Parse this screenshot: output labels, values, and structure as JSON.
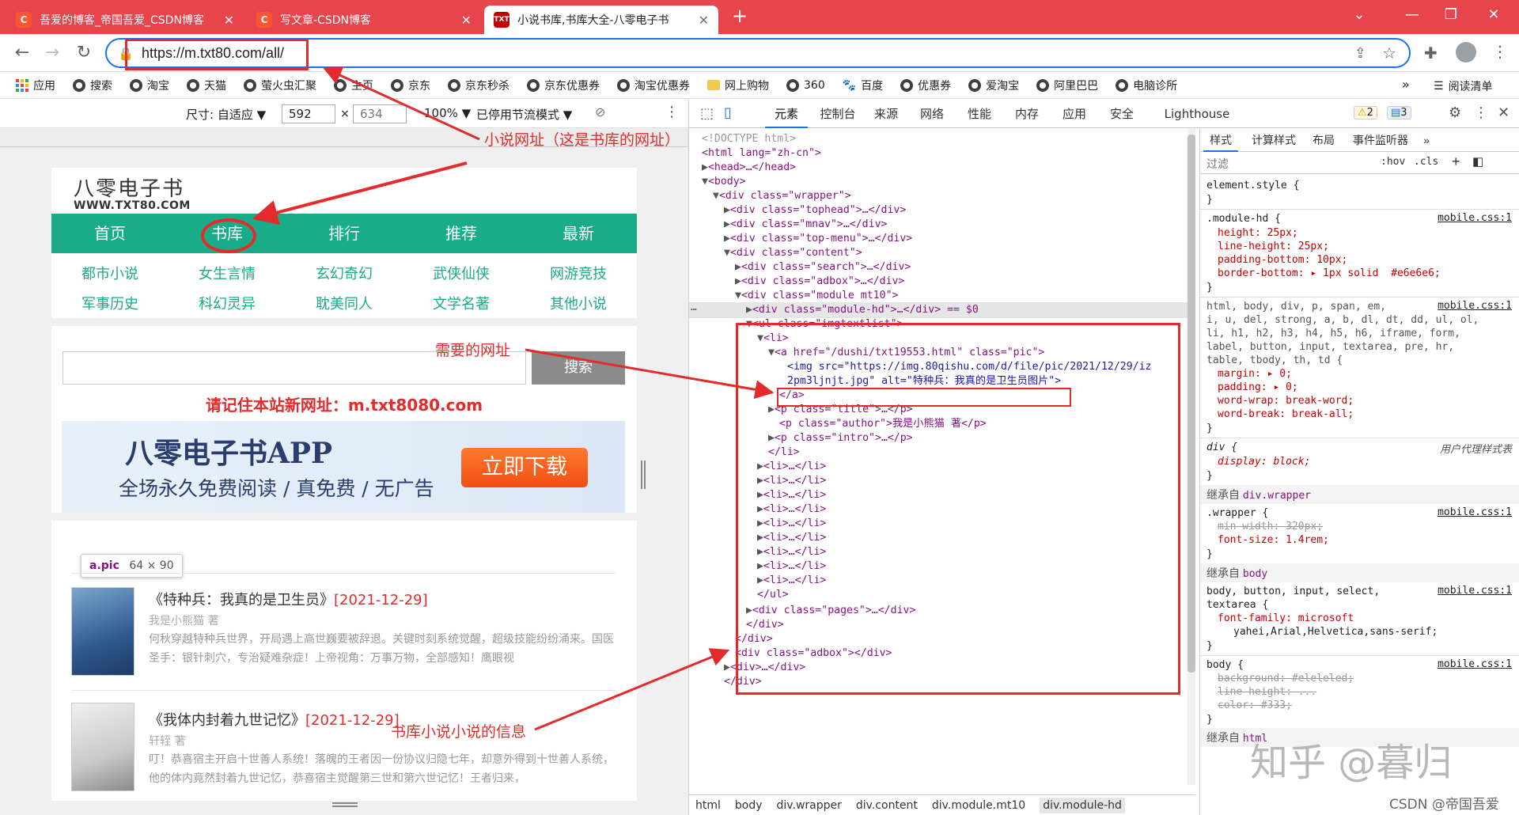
{
  "tabs": [
    {
      "title": "吾爱的博客_帝国吾爱_CSDN博客",
      "favicon": "C"
    },
    {
      "title": "写文章-CSDN博客",
      "favicon": "C"
    },
    {
      "title": "小说书库,书库大全-八零电子书",
      "favicon": "TXT"
    }
  ],
  "new_tab": "+",
  "window_controls": {
    "minimize": "—",
    "maximize": "❐",
    "close": "✕",
    "collapse": "⌄"
  },
  "address": {
    "url": "https://m.txt80.com/all/"
  },
  "bookmarks": [
    "应用",
    "搜索",
    "淘宝",
    "天猫",
    "萤火虫汇聚",
    "主页",
    "京东",
    "京东秒杀",
    "京东优惠券",
    "淘宝优惠券",
    "网上购物",
    "360",
    "百度",
    "优惠券",
    "爱淘宝",
    "阿里巴巴",
    "电脑诊所"
  ],
  "bookmarks_more": "»",
  "reading_list": "阅读清单",
  "device_toolbar": {
    "size_label": "尺寸: 自适应 ▼",
    "width": "592",
    "times": "×",
    "height": "634",
    "zoom": "100% ▼",
    "throttle": "已停用节流模式 ▼"
  },
  "mobile": {
    "brand_name": "八零电子书",
    "brand_url": "WWW.TXT80.COM",
    "nav": [
      "首页",
      "书库",
      "排行",
      "推荐",
      "最新"
    ],
    "categories": [
      "都市小说",
      "女生言情",
      "玄幻奇幻",
      "武侠仙侠",
      "网游竞技",
      "军事历史",
      "科幻灵异",
      "耽美同人",
      "文学名著",
      "其他小说"
    ],
    "search_button": "搜索",
    "notice": "请记住本站新网址：m.txt8080.com",
    "banner": {
      "title": "八零电子书APP",
      "subtitle": "全场永久免费阅读 / 真免费 / 无广告",
      "button": "立即下载"
    },
    "tooltip": {
      "selector": "a.pic",
      "size": "64 × 90"
    },
    "books": [
      {
        "title": "《特种兵：我真的是卫生员》",
        "date": "[2021-12-29]",
        "author": "我是小熊猫 著",
        "intro": "何秋穿越特种兵世界，开局遇上高世巍要被辞退。关键时刻系统觉醒，超级技能纷纷涌来。国医圣手：银针刺穴，专治疑难杂症！上帝视角：万事万物，全部感知！鹰眼视"
      },
      {
        "title": "《我体内封着九世记忆》",
        "date": "[2021-12-29]",
        "author": "轩轾 著",
        "intro": "叮！恭喜宿主开启十世善人系统！落魄的王者因一份协议归隐七年，却意外得到十世善人系统，他的体内竟然封着九世记忆，恭喜宿主觉醒第三世和第六世记忆！王者归来，"
      }
    ]
  },
  "devtools": {
    "tabs": [
      "元素",
      "控制台",
      "来源",
      "网络",
      "性能",
      "内存",
      "应用",
      "安全",
      "Lighthouse"
    ],
    "warnings": "2",
    "messages": "3",
    "dom_lines": [
      "<!DOCTYPE html>",
      "<html lang=\"zh-cn\">",
      "<head>…</head>",
      "<body>",
      "<div class=\"wrapper\">",
      "<div class=\"tophead\">…</div>",
      "<div class=\"mnav\">…</div>",
      "<div class=\"top-menu\">…</div>",
      "<div class=\"content\">",
      "<div class=\"search\">…</div>",
      "<div class=\"adbox\">…</div>",
      "<div class=\"module mt10\">",
      "<div class=\"module-hd\">…</div> == $0",
      "<ul class=\"imgtextlist\">",
      "<li>",
      "<a href=\"/dushi/txt19553.html\" class=\"pic\">",
      "<img src=\"https://img.80qishu.com/d/file/pic/2021/12/29/iz",
      "2pm3ljnjt.jpg\" alt=\"特种兵：我真的是卫生员图片\">",
      "</a>",
      "<p class=\"title\">…</p>",
      "<p class=\"author\">我是小熊猫 著</p>",
      "<p class=\"intro\">…</p>",
      "</li>",
      "<li>…</li>",
      "<li>…</li>",
      "<li>…</li>",
      "<li>…</li>",
      "<li>…</li>",
      "<li>…</li>",
      "<li>…</li>",
      "<li>…</li>",
      "<li>…</li>",
      "</ul>",
      "<div class=\"pages\">…</div>",
      "</div>",
      "</div>",
      "<div class=\"adbox\"></div>",
      "<div>…</div>",
      "</div>"
    ],
    "breadcrumbs": [
      "html",
      "body",
      "div.wrapper",
      "div.content",
      "div.module.mt10",
      "div.module-hd"
    ],
    "styles_tabs": [
      "样式",
      "计算样式",
      "布局",
      "事件监听器",
      "»"
    ],
    "filter_placeholder": "过滤",
    "hov": ":hov",
    "cls": ".cls",
    "css": {
      "element_style": "element.style {",
      "rule1_sel": ".module-hd {",
      "rule1_src": "mobile.css:1",
      "rule1_props": [
        "height: 25px;",
        "line-height: 25px;",
        "padding-bottom: 10px;",
        "border-bottom: ▸ 1px solid  #e6e6e6;"
      ],
      "rule2_sel": [
        "html, body, div, p, span, em,",
        "i, u, del, strong, a, b, dl, dt, dd, ul, ol,",
        "li, h1, h2, h3, h4, h5, h6, iframe, form,",
        "label, button, input, textarea, pre, hr,",
        "table, tbody, th, td {"
      ],
      "rule2_src": "mobile.css:1",
      "rule2_props": [
        "margin: ▸ 0;",
        "padding: ▸ 0;",
        "word-wrap: break-word;",
        "word-break: break-all;"
      ],
      "ua_sel": "div {",
      "ua_src": "用户代理样式表",
      "ua_prop": "display: block;",
      "inh1": "继承自",
      "inh1_sel": "div.wrapper",
      "rule3_sel": ".wrapper {",
      "rule3_src": "mobile.css:1",
      "rule3_props": [
        "min-width: 320px;",
        "font-size: 1.4rem;"
      ],
      "inh2_sel": "body",
      "rule4_sel": [
        "body, button, input, select,",
        "textarea {"
      ],
      "rule4_src": "mobile.css:1",
      "rule4_props": [
        "font-family: microsoft",
        "yahei,Arial,Helvetica,sans-serif;"
      ],
      "rule5_sel": "body {",
      "rule5_src": "mobile.css:1",
      "rule5_props": [
        "background: #eleleled;",
        "line-height: ...",
        "color: #333;"
      ],
      "inh3_sel": "html"
    }
  },
  "annotations": {
    "url_note": "小说网址（这是书库的网址）",
    "needed_url": "需要的网址",
    "book_info": "书库小说小说的信息"
  },
  "watermarks": {
    "zhihu": "知乎 @暮归",
    "csdn": "CSDN @帝国吾爱"
  },
  "colors": {
    "chrome_red": "#e8444c",
    "site_green": "#1aab88",
    "annotation_red": "#e32b2b",
    "focus_blue": "#1a73e8"
  }
}
